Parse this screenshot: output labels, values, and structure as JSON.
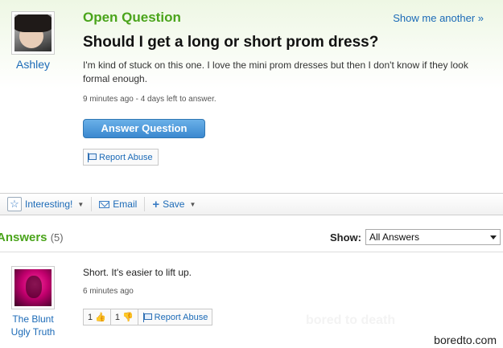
{
  "question": {
    "section_label": "Open Question",
    "show_another": "Show me another »",
    "asker": "Ashley",
    "title": "Should I get a long or short prom dress?",
    "body": "I'm kind of stuck on this one. I love the mini prom dresses but then I don't know if they look formal enough.",
    "meta": "9 minutes ago - 4 days left to answer.",
    "answer_button": "Answer Question",
    "report_abuse": "Report Abuse"
  },
  "actions": {
    "interesting": "Interesting!",
    "email": "Email",
    "save": "Save"
  },
  "answers": {
    "heading": "Answers",
    "count": "(5)",
    "show_label": "Show:",
    "show_selected": "All Answers",
    "items": [
      {
        "author_line1": "The Blunt",
        "author_line2": "Ugly Truth",
        "text": "Short. It's easier to lift up.",
        "meta": "6 minutes ago",
        "thumbs_up": "1",
        "thumbs_down": "1",
        "report_abuse": "Report Abuse"
      }
    ]
  },
  "watermark": "bored to death",
  "credit": "boredto.com",
  "icons": [
    "flag-icon",
    "star-icon",
    "mail-icon",
    "plus-icon",
    "thumbs-up-icon",
    "thumbs-down-icon",
    "chevron-down-icon"
  ],
  "colors": {
    "accent_green": "#4aa41b",
    "link_blue": "#1b6ab7",
    "button_blue": "#3a88cf"
  }
}
